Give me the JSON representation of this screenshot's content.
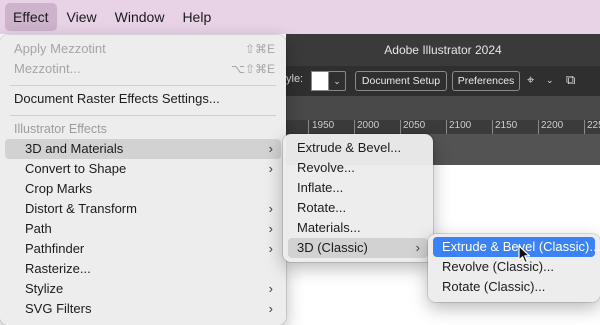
{
  "menubar": {
    "items": [
      "Effect",
      "View",
      "Window",
      "Help"
    ],
    "active": "Effect"
  },
  "app": {
    "title": "Adobe Illustrator 2024",
    "control_bar": {
      "style_label": "yle:",
      "document_setup": "Document Setup",
      "preferences": "Preferences"
    },
    "ruler_labels": [
      "1950",
      "2000",
      "2050",
      "2100",
      "2150",
      "2200",
      "225"
    ]
  },
  "effect_menu": {
    "apply_label": "Apply Mezzotint",
    "apply_shortcut": "⇧⌘E",
    "last_effect_label": "Mezzotint...",
    "last_effect_shortcut": "⌥⇧⌘E",
    "document_raster": "Document Raster Effects Settings...",
    "illustrator_header": "Illustrator Effects",
    "items": [
      {
        "label": "3D and Materials",
        "submenu": true
      },
      {
        "label": "Convert to Shape",
        "submenu": true
      },
      {
        "label": "Crop Marks",
        "submenu": false
      },
      {
        "label": "Distort & Transform",
        "submenu": true
      },
      {
        "label": "Path",
        "submenu": true
      },
      {
        "label": "Pathfinder",
        "submenu": true
      },
      {
        "label": "Rasterize...",
        "submenu": false
      },
      {
        "label": "Stylize",
        "submenu": true
      },
      {
        "label": "SVG Filters",
        "submenu": true
      }
    ]
  },
  "materials_submenu": {
    "items": [
      {
        "label": "Extrude & Bevel...",
        "submenu": false
      },
      {
        "label": "Revolve...",
        "submenu": false
      },
      {
        "label": "Inflate...",
        "submenu": false
      },
      {
        "label": "Rotate...",
        "submenu": false
      },
      {
        "label": "Materials...",
        "submenu": false
      },
      {
        "label": "3D (Classic)",
        "submenu": true
      }
    ]
  },
  "classic_submenu": {
    "items": [
      {
        "label": "Extrude & Bevel (Classic)..."
      },
      {
        "label": "Revolve (Classic)..."
      },
      {
        "label": "Rotate (Classic)..."
      }
    ]
  },
  "icons": {
    "submenu_arrow": "›"
  },
  "colors": {
    "menubar_bg": "#e8d2e6",
    "selection_blue": "#3b82f6",
    "app_dark": "#2f2f2f"
  }
}
